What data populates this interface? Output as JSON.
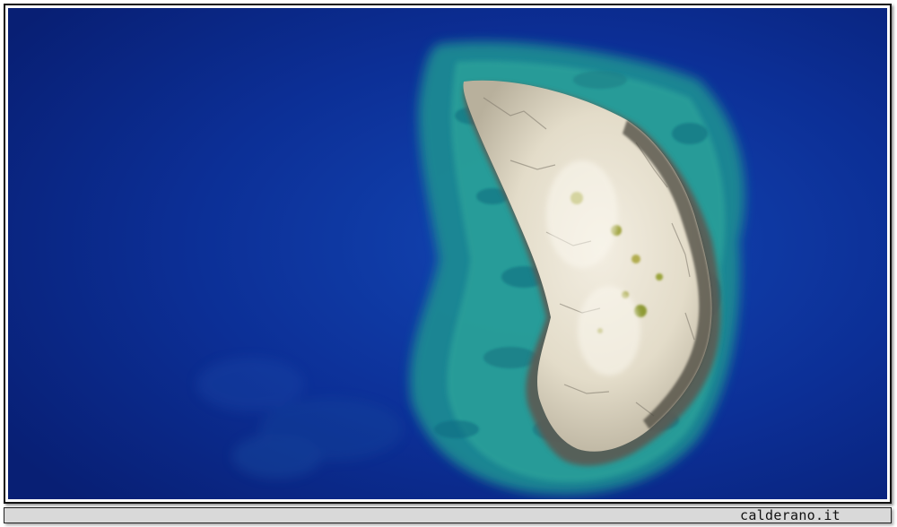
{
  "photo": {
    "subject": "island-aerial-view",
    "colors": {
      "deep_sea": "#0b2a8a",
      "mid_sea": "#0f3fa8",
      "shallow_sea": "#1a9a9a",
      "reef": "#2a8f86",
      "rock": "#e9e2d2",
      "rock_shadow": "#6d6a60",
      "vegetation": "#9aa33a"
    }
  },
  "caption": {
    "watermark": "calderano.it"
  }
}
